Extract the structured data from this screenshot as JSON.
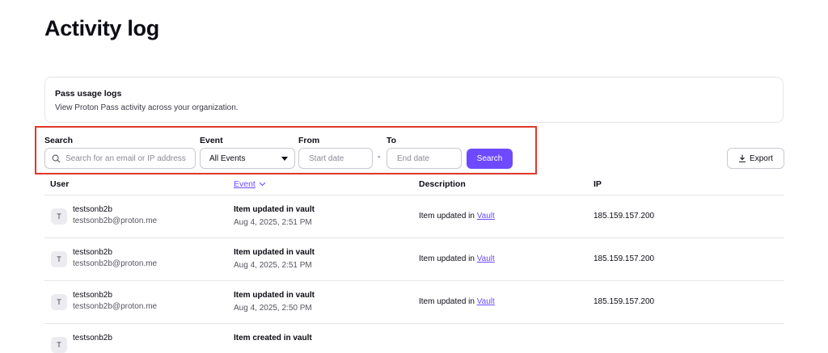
{
  "page": {
    "title": "Activity log"
  },
  "info_card": {
    "title": "Pass usage logs",
    "subtitle": "View Proton Pass activity across your organization."
  },
  "filters": {
    "search_label": "Search",
    "search_placeholder": "Search for an email or IP address",
    "event_label": "Event",
    "event_value": "All Events",
    "from_label": "From",
    "from_placeholder": "Start date",
    "to_label": "To",
    "to_placeholder": "End date",
    "range_separator": "-",
    "search_button": "Search"
  },
  "export_button": "Export",
  "table": {
    "columns": {
      "user": "User",
      "event": "Event",
      "description": "Description",
      "ip": "IP"
    },
    "rows": [
      {
        "avatar": "T",
        "name": "testsonb2b",
        "email": "testsonb2b@proton.me",
        "event": "Item updated in vault",
        "date": "Aug 4, 2025, 2:51 PM",
        "desc_prefix": "Item updated in ",
        "desc_link": "Vault",
        "ip": "185.159.157.200"
      },
      {
        "avatar": "T",
        "name": "testsonb2b",
        "email": "testsonb2b@proton.me",
        "event": "Item updated in vault",
        "date": "Aug 4, 2025, 2:51 PM",
        "desc_prefix": "Item updated in ",
        "desc_link": "Vault",
        "ip": "185.159.157.200"
      },
      {
        "avatar": "T",
        "name": "testsonb2b",
        "email": "testsonb2b@proton.me",
        "event": "Item updated in vault",
        "date": "Aug 4, 2025, 2:50 PM",
        "desc_prefix": "Item updated in ",
        "desc_link": "Vault",
        "ip": "185.159.157.200"
      },
      {
        "avatar": "T",
        "name": "testsonb2b",
        "email": "",
        "event": "Item created in vault",
        "date": "",
        "desc_prefix": "",
        "desc_link": "",
        "ip": ""
      }
    ]
  },
  "colors": {
    "accent": "#6d4aff",
    "highlight_border": "#e0382a",
    "border": "#e5e5ea"
  },
  "icons": {
    "search": "search-icon",
    "select": "caret-down-icon",
    "sort": "chevron-down-icon",
    "export": "download-icon"
  }
}
